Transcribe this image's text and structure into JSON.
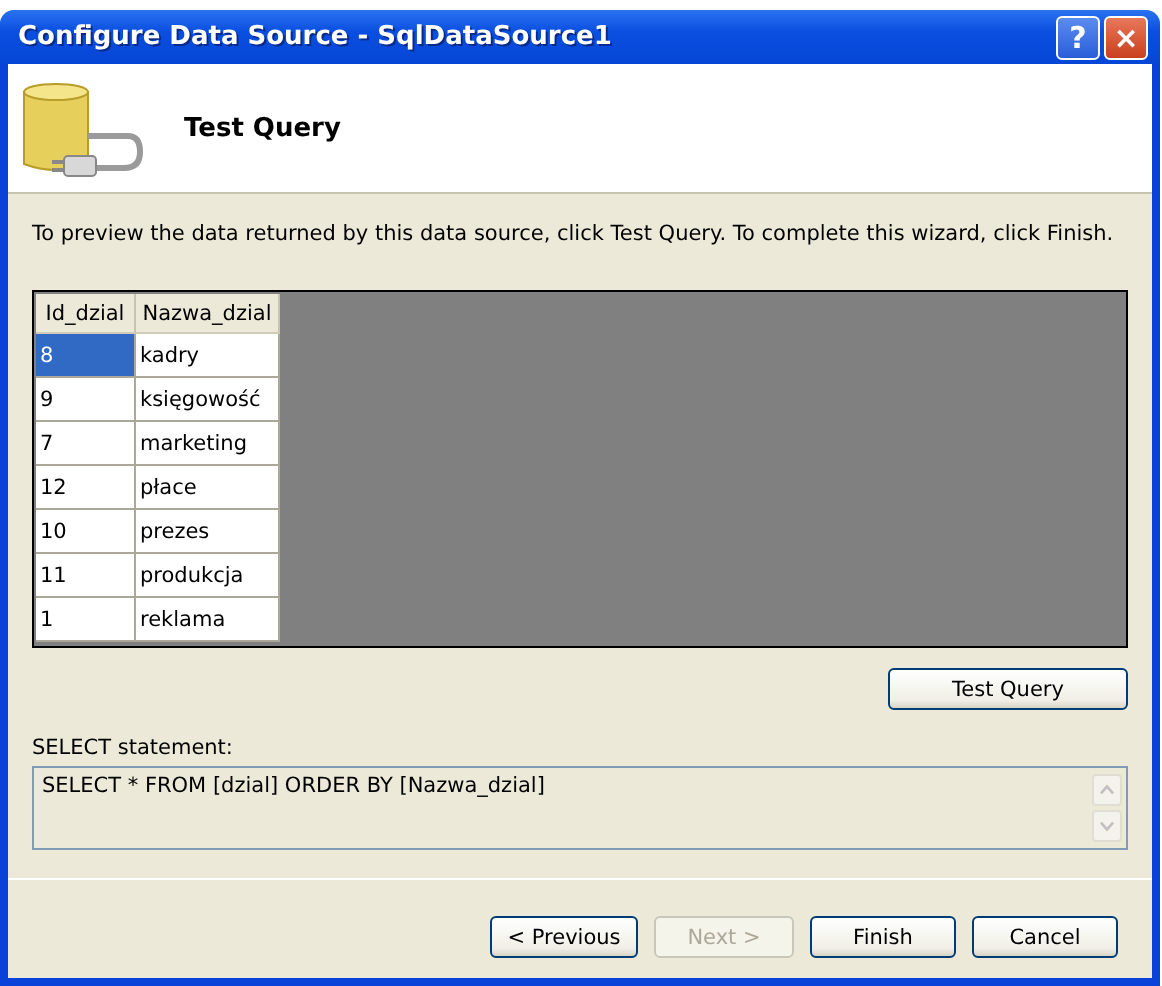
{
  "window": {
    "title": "Configure Data Source - SqlDataSource1",
    "help_button": "?",
    "close_button": "×"
  },
  "header": {
    "title": "Test Query"
  },
  "instructions": "To preview the data returned by this data source, click Test Query. To complete this wizard, click Finish.",
  "grid": {
    "columns": [
      "Id_dzial",
      "Nazwa_dzial"
    ],
    "rows": [
      {
        "cells": [
          "8",
          "kadry"
        ],
        "selected": true
      },
      {
        "cells": [
          "9",
          "księgowość"
        ],
        "selected": false
      },
      {
        "cells": [
          "7",
          "marketing"
        ],
        "selected": false
      },
      {
        "cells": [
          "12",
          "płace"
        ],
        "selected": false
      },
      {
        "cells": [
          "10",
          "prezes"
        ],
        "selected": false
      },
      {
        "cells": [
          "11",
          "produkcja"
        ],
        "selected": false
      },
      {
        "cells": [
          "1",
          "reklama"
        ],
        "selected": false
      }
    ]
  },
  "test_query_button": "Test Query",
  "select_label": "SELECT statement:",
  "select_statement": "SELECT * FROM [dzial] ORDER BY [Nazwa_dzial]",
  "buttons": [
    {
      "label": "< Previous",
      "disabled": false
    },
    {
      "label": "Next >",
      "disabled": true
    },
    {
      "label": "Finish",
      "disabled": false
    },
    {
      "label": "Cancel",
      "disabled": false
    }
  ]
}
